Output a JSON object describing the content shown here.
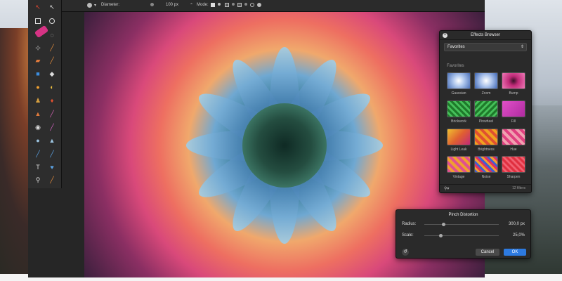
{
  "top_bar": {
    "diameter_label": "Diameter:",
    "diameter_value": "100 px",
    "mode_label": "Mode:"
  },
  "effects_browser": {
    "title": "Effects Browser",
    "category": "Favorites",
    "section_label": "Favorites",
    "count": "12 filters",
    "effects": [
      {
        "label": "Gaussian"
      },
      {
        "label": "Zoom"
      },
      {
        "label": "Bump"
      },
      {
        "label": "Brickwork"
      },
      {
        "label": "Pinwheel"
      },
      {
        "label": "Fill"
      },
      {
        "label": "Light Leak"
      },
      {
        "label": "Brightness"
      },
      {
        "label": "Hue"
      },
      {
        "label": "Vintage"
      },
      {
        "label": "Noise"
      },
      {
        "label": "Sharpen"
      }
    ]
  },
  "pinch_distortion": {
    "title": "Pinch Distortion",
    "radius_label": "Radius:",
    "radius_value": "300,0 px",
    "scale_label": "Scale:",
    "scale_value": "25,0%",
    "cancel_label": "Cancel",
    "ok_label": "OK"
  }
}
